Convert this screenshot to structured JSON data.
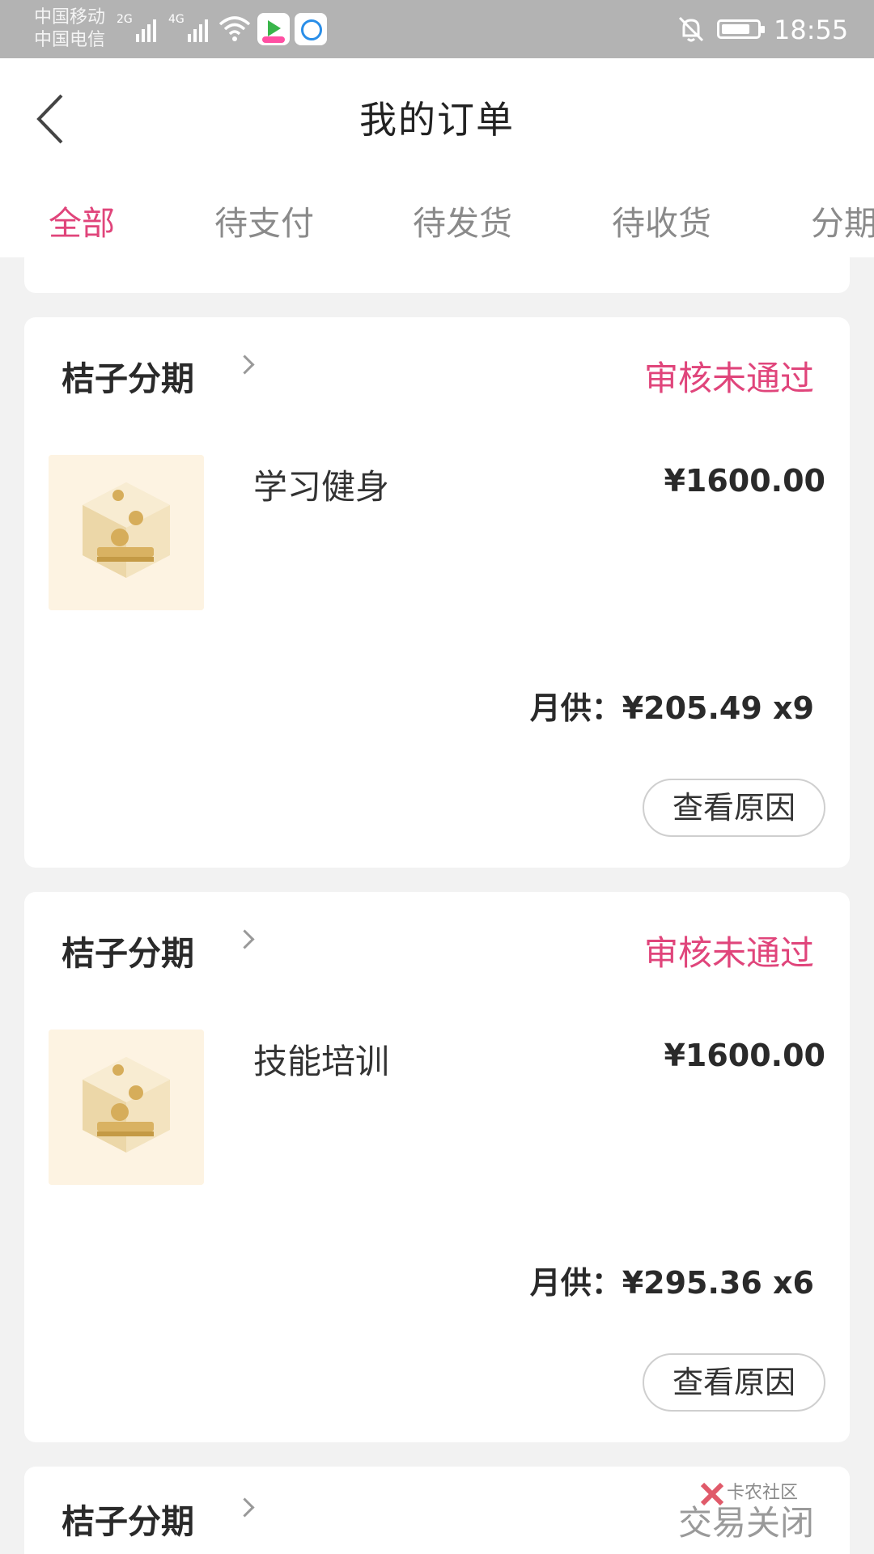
{
  "status_bar": {
    "carrier1": "中国移动",
    "carrier2": "中国电信",
    "network1": "2G",
    "network2": "4G",
    "time": "18:55",
    "battery_level": 0.8
  },
  "header": {
    "title": "我的订单"
  },
  "tabs": [
    {
      "label": "全部",
      "active": true
    },
    {
      "label": "待支付",
      "active": false
    },
    {
      "label": "待发货",
      "active": false
    },
    {
      "label": "待收货",
      "active": false
    },
    {
      "label": "分期",
      "active": false
    }
  ],
  "orders": [
    {
      "merchant": "桔子分期",
      "status": "审核未通过",
      "product": "学习健身",
      "price": "¥1600.00",
      "monthly_label": "月供：",
      "monthly_value": "¥205.49 x9",
      "action": "查看原因"
    },
    {
      "merchant": "桔子分期",
      "status": "审核未通过",
      "product": "技能培训",
      "price": "¥1600.00",
      "monthly_label": "月供：",
      "monthly_value": "¥295.36 x6",
      "action": "查看原因"
    },
    {
      "merchant": "桔子分期",
      "status": "交易关闭"
    }
  ],
  "watermark": "卡农社区",
  "colors": {
    "accent": "#e0457b",
    "status_bar": "#b3b3b3",
    "background": "#f2f2f2"
  }
}
